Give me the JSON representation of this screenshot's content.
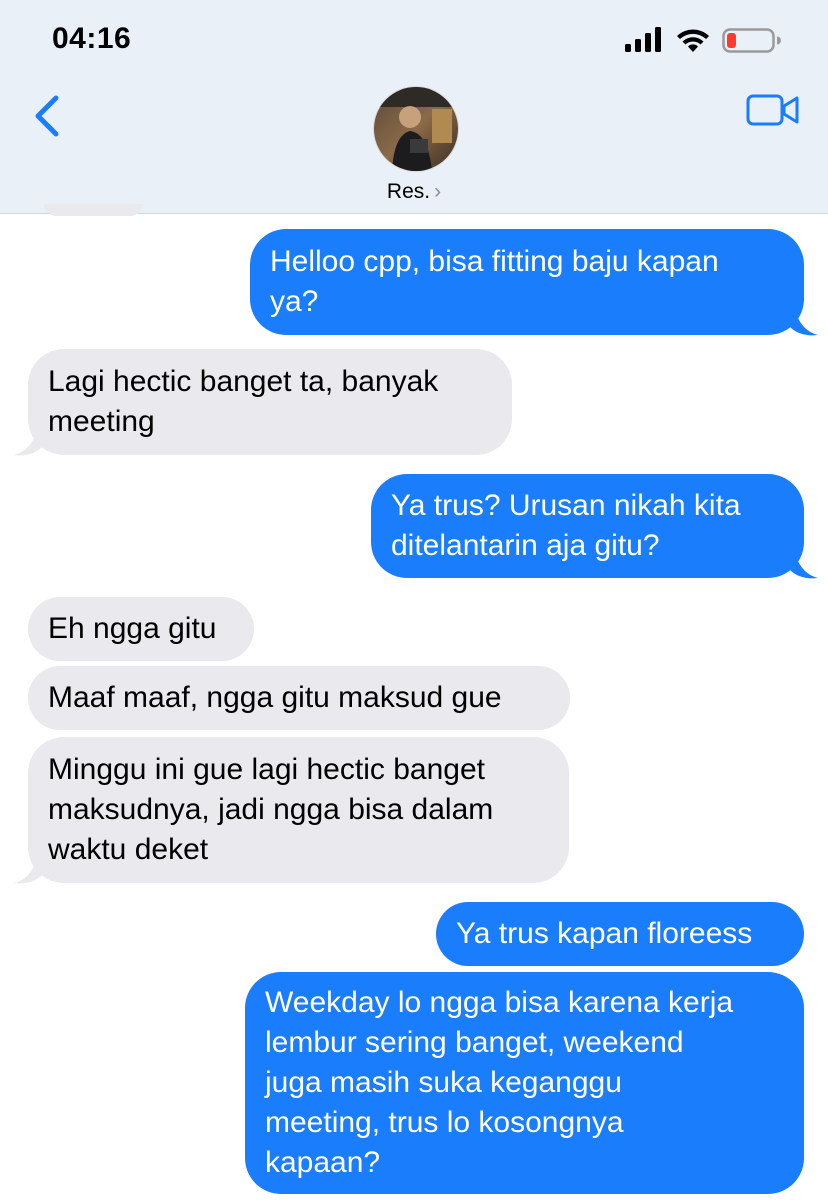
{
  "status_bar": {
    "time": "04:16",
    "signal_icon": "cellular-signal-icon",
    "wifi_icon": "wifi-icon",
    "battery_icon": "battery-low-icon",
    "battery_color": "#ff3b30"
  },
  "header": {
    "back_icon": "chevron-left-icon",
    "contact_name": "Res.",
    "contact_chevron": "›",
    "video_icon": "video-camera-icon",
    "accent_color": "#1a7dfc"
  },
  "messages": [
    {
      "direction": "outgoing",
      "text": "Helloo cpp, bisa fitting baju kapan\nya?"
    },
    {
      "direction": "incoming",
      "text": "Lagi hectic banget ta, banyak\nmeeting"
    },
    {
      "direction": "outgoing",
      "text": "Ya trus? Urusan nikah kita\nditelantarin aja gitu?"
    },
    {
      "direction": "incoming",
      "text": "Eh ngga gitu"
    },
    {
      "direction": "incoming",
      "text": "Maaf maaf, ngga gitu maksud gue"
    },
    {
      "direction": "incoming",
      "text": "Minggu ini gue lagi hectic banget\nmaksudnya, jadi ngga bisa dalam\nwaktu deket"
    },
    {
      "direction": "outgoing",
      "text": "Ya trus kapan floreess"
    },
    {
      "direction": "outgoing",
      "text": "Weekday lo ngga bisa karena kerja\nlembur sering banget, weekend\njuga masih suka keganggu\nmeeting, trus lo kosongnya\nkapaan?"
    }
  ]
}
